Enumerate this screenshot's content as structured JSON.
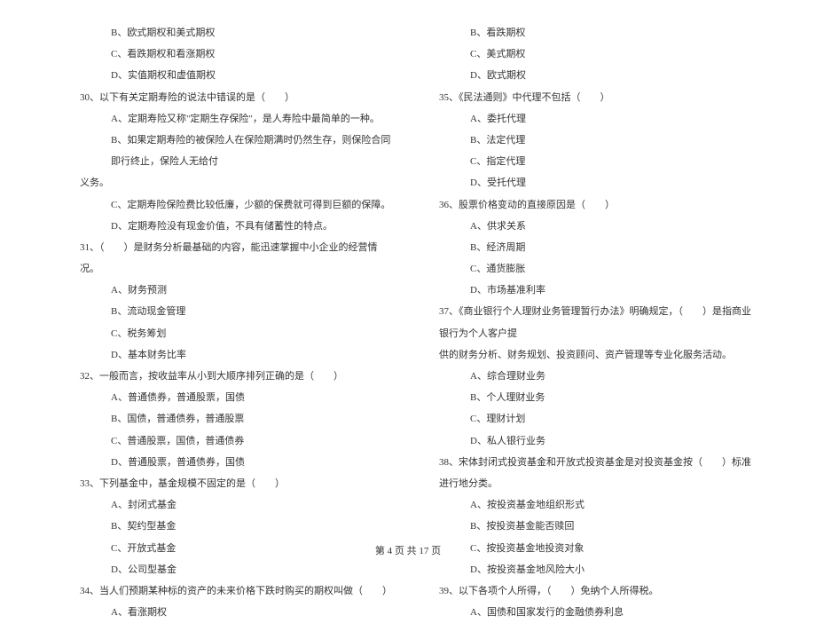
{
  "left_column": [
    {
      "type": "option",
      "text": "B、欧式期权和美式期权"
    },
    {
      "type": "option",
      "text": "C、看跌期权和看涨期权"
    },
    {
      "type": "option",
      "text": "D、实值期权和虚值期权"
    },
    {
      "type": "question",
      "text": "30、以下有关定期寿险的说法中错误的是（　　）"
    },
    {
      "type": "option",
      "text": "A、定期寿险又称\"定期生存保险\"，是人寿险中最简单的一种。"
    },
    {
      "type": "option",
      "text": "B、如果定期寿险的被保险人在保险期满时仍然生存，则保险合同即行终止，保险人无给付"
    },
    {
      "type": "continuation",
      "text": "义务。"
    },
    {
      "type": "option",
      "text": "C、定期寿险保险费比较低廉，少额的保费就可得到巨额的保障。"
    },
    {
      "type": "option",
      "text": "D、定期寿险没有现金价值，不具有储蓄性的特点。"
    },
    {
      "type": "question",
      "text": "31、（　　）是财务分析最基础的内容，能迅速掌握中小企业的经营情况。"
    },
    {
      "type": "option",
      "text": "A、财务预测"
    },
    {
      "type": "option",
      "text": "B、流动现金管理"
    },
    {
      "type": "option",
      "text": "C、税务筹划"
    },
    {
      "type": "option",
      "text": "D、基本财务比率"
    },
    {
      "type": "question",
      "text": "32、一般而言，按收益率从小到大顺序排列正确的是（　　）"
    },
    {
      "type": "option",
      "text": "A、普通债券，普通股票，国债"
    },
    {
      "type": "option",
      "text": "B、国债，普通债券，普通股票"
    },
    {
      "type": "option",
      "text": "C、普通股票，国债，普通债券"
    },
    {
      "type": "option",
      "text": "D、普通股票，普通债券，国债"
    },
    {
      "type": "question",
      "text": "33、下列基金中，基金规模不固定的是（　　）"
    },
    {
      "type": "option",
      "text": "A、封闭式基金"
    },
    {
      "type": "option",
      "text": "B、契约型基金"
    },
    {
      "type": "option",
      "text": "C、开放式基金"
    },
    {
      "type": "option",
      "text": "D、公司型基金"
    },
    {
      "type": "question",
      "text": "34、当人们预期某种标的资产的未来价格下跌时购买的期权叫做（　　）"
    },
    {
      "type": "option",
      "text": "A、看涨期权"
    }
  ],
  "right_column": [
    {
      "type": "option",
      "text": "B、看跌期权"
    },
    {
      "type": "option",
      "text": "C、美式期权"
    },
    {
      "type": "option",
      "text": "D、欧式期权"
    },
    {
      "type": "question",
      "text": "35、《民法通则》中代理不包括（　　）"
    },
    {
      "type": "option",
      "text": "A、委托代理"
    },
    {
      "type": "option",
      "text": "B、法定代理"
    },
    {
      "type": "option",
      "text": "C、指定代理"
    },
    {
      "type": "option",
      "text": "D、受托代理"
    },
    {
      "type": "question",
      "text": "36、股票价格变动的直接原因是（　　）"
    },
    {
      "type": "option",
      "text": "A、供求关系"
    },
    {
      "type": "option",
      "text": "B、经济周期"
    },
    {
      "type": "option",
      "text": "C、通货膨胀"
    },
    {
      "type": "option",
      "text": "D、市场基准利率"
    },
    {
      "type": "question",
      "text": "37、《商业银行个人理财业务管理暂行办法》明确规定，（　　）是指商业银行为个人客户提"
    },
    {
      "type": "continuation",
      "text": "供的财务分析、财务规划、投资顾问、资产管理等专业化服务活动。"
    },
    {
      "type": "option",
      "text": "A、综合理财业务"
    },
    {
      "type": "option",
      "text": "B、个人理财业务"
    },
    {
      "type": "option",
      "text": "C、理财计划"
    },
    {
      "type": "option",
      "text": "D、私人银行业务"
    },
    {
      "type": "question",
      "text": "38、宋体封闭式投资基金和开放式投资基金是对投资基金按（　　）标准进行地分类。"
    },
    {
      "type": "option",
      "text": "A、按投资基金地组织形式"
    },
    {
      "type": "option",
      "text": "B、按投资基金能否赎回"
    },
    {
      "type": "option",
      "text": "C、按投资基金地投资对象"
    },
    {
      "type": "option",
      "text": "D、按投资基金地风险大小"
    },
    {
      "type": "question",
      "text": "39、以下各项个人所得，（　　）免纳个人所得税。"
    },
    {
      "type": "option",
      "text": "A、国债和国家发行的金融债券利息"
    }
  ],
  "footer": "第 4 页 共 17 页"
}
